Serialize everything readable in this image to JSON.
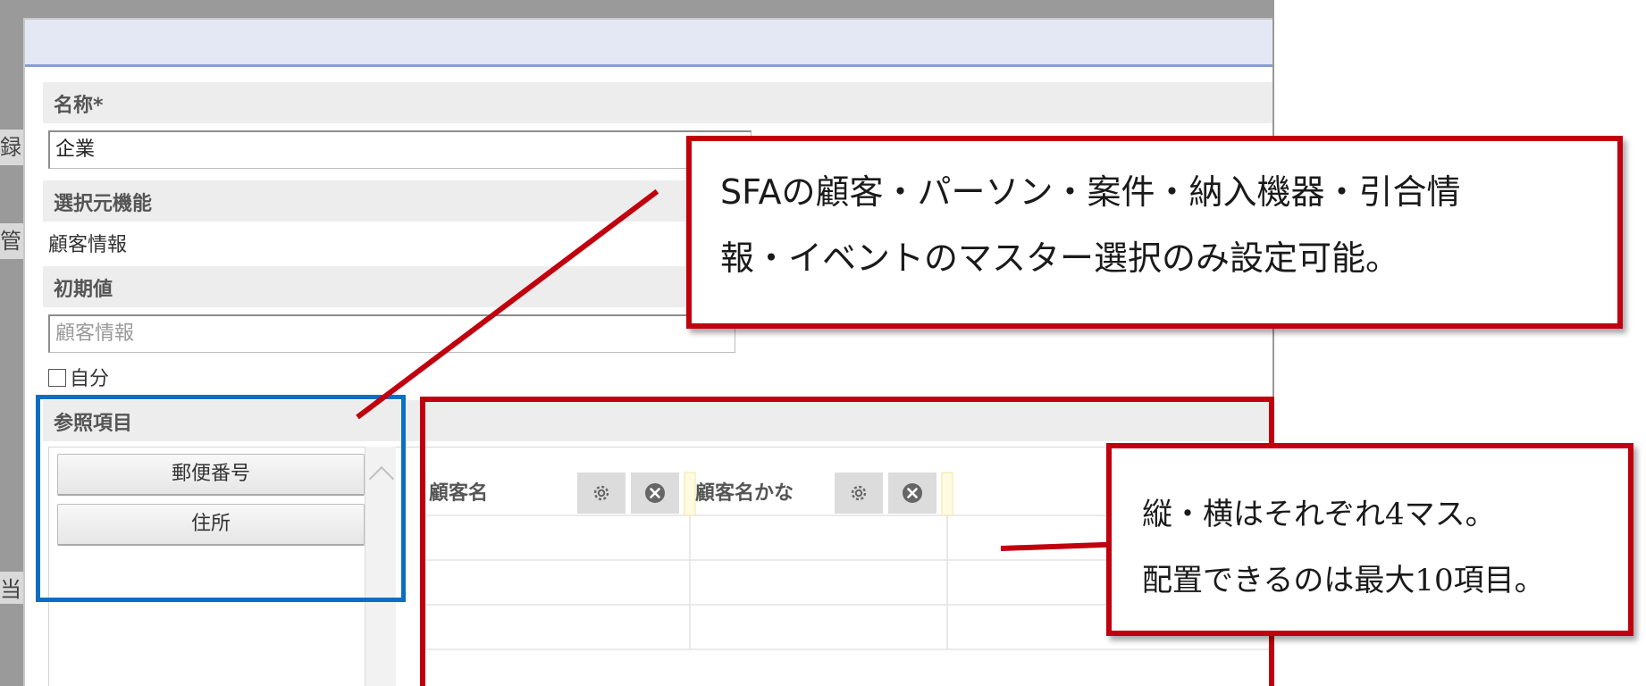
{
  "background": {
    "fragments": [
      "録",
      "管",
      "当"
    ]
  },
  "dialog": {
    "name_field": {
      "label": "名称*",
      "value": "企業"
    },
    "source_function": {
      "label": "選択元機能",
      "value": "顧客情報"
    },
    "initial_value": {
      "label": "初期値",
      "placeholder": "顧客情報",
      "checkbox_label": "自分",
      "checked": false
    },
    "reference_items": {
      "label": "参照項目",
      "available": [
        "郵便番号",
        "住所"
      ]
    },
    "layout_grid": {
      "rows": 4,
      "cols": 4,
      "placed": [
        {
          "label": "顧客名"
        },
        {
          "label": "顧客名かな"
        }
      ]
    }
  },
  "annotations": {
    "callout_top": {
      "line1": "SFAの顧客・パーソン・案件・納入機器・引合情",
      "line2": "報・イベントのマスター選択のみ設定可能。"
    },
    "callout_right": {
      "line1": "縦・横はそれぞれ4マス。",
      "line2": "配置できるのは最大10項目。"
    },
    "colors": {
      "callout_border": "#c0000f",
      "highlight_border": "#0a6fc2"
    }
  }
}
